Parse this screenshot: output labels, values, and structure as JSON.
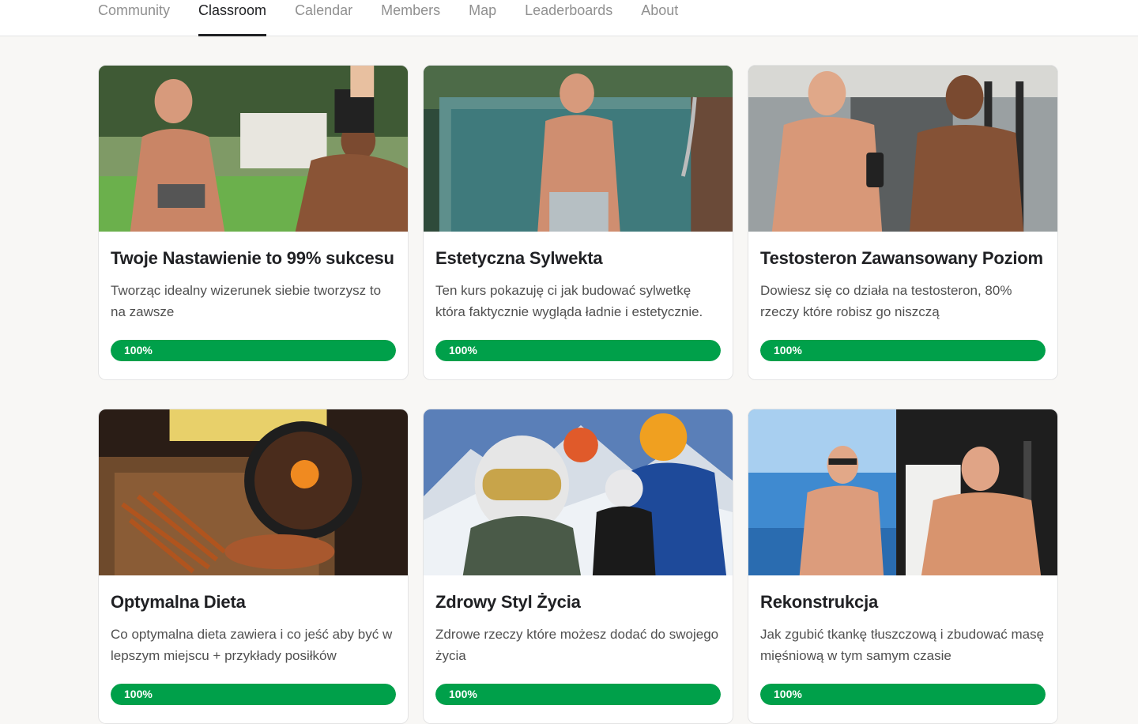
{
  "nav": {
    "tabs": [
      {
        "label": "Community",
        "active": false
      },
      {
        "label": "Classroom",
        "active": true
      },
      {
        "label": "Calendar",
        "active": false
      },
      {
        "label": "Members",
        "active": false
      },
      {
        "label": "Map",
        "active": false
      },
      {
        "label": "Leaderboards",
        "active": false
      },
      {
        "label": "About",
        "active": false
      }
    ]
  },
  "courses": [
    {
      "title": "Twoje Nastawienie to 99% sukcesu",
      "description": "Tworząc idealny wizerunek siebie tworzysz to na zawsze",
      "progress": 100,
      "progress_label": "100%",
      "image": "poolside-photo"
    },
    {
      "title": "Estetyczna Sylwekta",
      "description": "Ten kurs pokazuję ci jak budować sylwetkę która faktycznie wygląda ładnie i estetycznie.",
      "progress": 100,
      "progress_label": "100%",
      "image": "cold-plunge-photo"
    },
    {
      "title": "Testosteron Zawansowany Poziom",
      "description": "Dowiesz się co działa na testosteron, 80% rzeczy które robisz go niszczą",
      "progress": 100,
      "progress_label": "100%",
      "image": "gym-mirror-photo"
    },
    {
      "title": "Optymalna Dieta",
      "description": "Co optymalna dieta zawiera i co jeść aby być w lepszym miejscu + przykłady posiłków",
      "progress": 100,
      "progress_label": "100%",
      "image": "food-plate-photo"
    },
    {
      "title": "Zdrowy Styl Życia",
      "description": "Zdrowe rzeczy które możesz dodać do swojego życia",
      "progress": 100,
      "progress_label": "100%",
      "image": "mountain-selfie-photo"
    },
    {
      "title": "Rekonstrukcja",
      "description": "Jak zgubić tkankę tłuszczową i zbudować masę mięśniową w tym samym czasie",
      "progress": 100,
      "progress_label": "100%",
      "image": "before-after-photo"
    }
  ],
  "colors": {
    "progress": "#00a04a",
    "active_tab": "#202124",
    "inactive_tab": "#909090"
  }
}
